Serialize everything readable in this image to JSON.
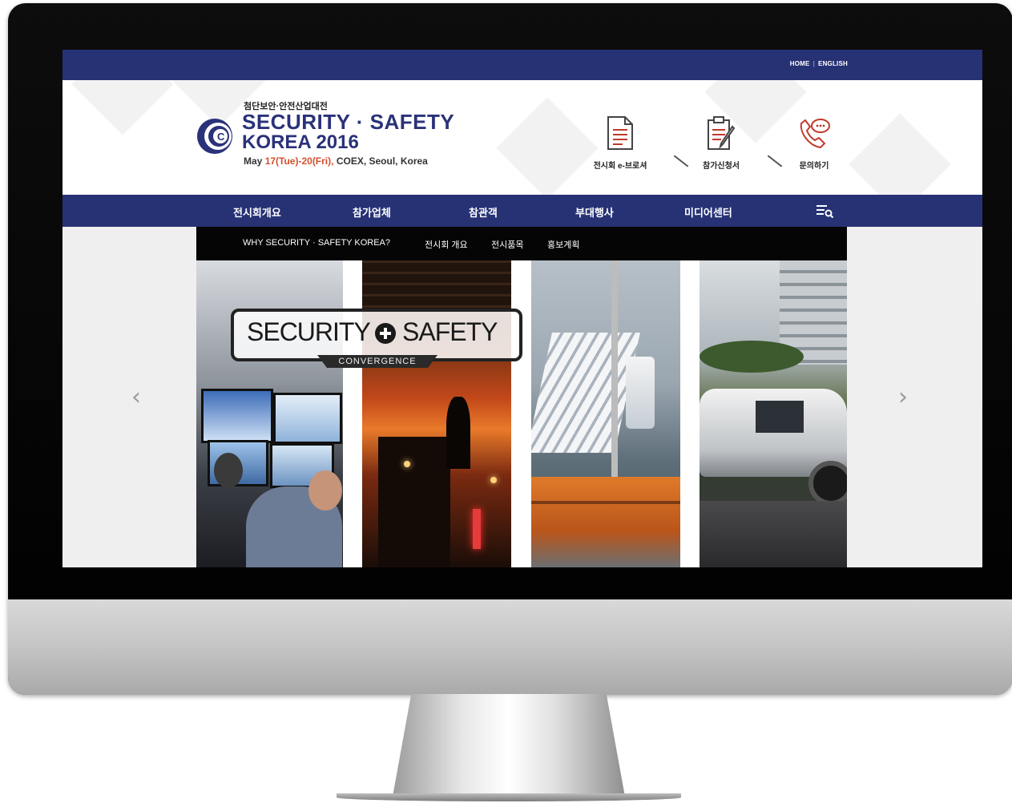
{
  "utility_nav": {
    "home": "HOME",
    "english": "ENGLISH"
  },
  "logo": {
    "korean_title": "첨단보안·안전산업대전",
    "line1": "SECURITY · SAFETY",
    "line2": "KOREA 2016",
    "date_prefix": "May ",
    "date_highlight": "17(Tue)-20(Fri),",
    "date_suffix": " COEX, Seoul, Korea"
  },
  "quick_links": [
    {
      "label": "전시회 e-브로셔",
      "icon": "document-icon"
    },
    {
      "label": "참가신청서",
      "icon": "clipboard-pen-icon"
    },
    {
      "label": "문의하기",
      "icon": "phone-chat-icon"
    }
  ],
  "main_nav": [
    "전시회개요",
    "참가업체",
    "참관객",
    "부대행사",
    "미디어센터"
  ],
  "sub_nav": [
    "WHY SECURITY · SAFETY KOREA?",
    "전시회 개요",
    "전시품목",
    "홍보계획"
  ],
  "hero": {
    "badge_word1": "SECURITY",
    "badge_word2": "SAFETY",
    "badge_sub": "CONVERGENCE",
    "prev_arrow": "‹",
    "next_arrow": "›"
  },
  "colors": {
    "navy": "#273275",
    "accent_orange": "#d34f2c",
    "icon_red": "#c0392b"
  }
}
